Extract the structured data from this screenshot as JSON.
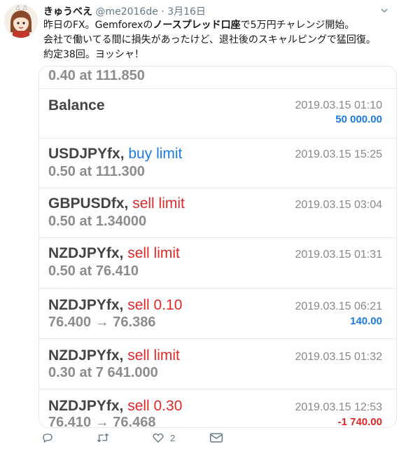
{
  "tweet": {
    "display_name": "きゅうべえ",
    "handle": "@me2016de",
    "separator": "·",
    "date": "3月16日",
    "text_line1_pre": "昨日のFX。Gemforexの",
    "text_line1_bold": "ノースプレッド口座",
    "text_line1_post": "で5万円チャレンジ開始。",
    "text_line2": "会社で働いてる間に損失があったけど、退社後のスキャルピングで猛回復。",
    "text_line3": "約定38回。ヨッシャ！"
  },
  "trades": [
    {
      "symbol": "",
      "action": "",
      "action_type": "",
      "detail": "0.40 at 111.850",
      "time": "",
      "profit": "",
      "profit_type": ""
    },
    {
      "symbol": "Balance",
      "action": "",
      "action_type": "",
      "detail": "",
      "time": "2019.03.15 01:10",
      "profit": "50 000.00",
      "profit_type": "positive"
    },
    {
      "symbol": "USDJPYfx",
      "action": "buy limit",
      "action_type": "buy",
      "detail": "0.50 at 111.300",
      "time": "2019.03.15 15:25",
      "profit": "",
      "profit_type": ""
    },
    {
      "symbol": "GBPUSDfx",
      "action": "sell limit",
      "action_type": "sell",
      "detail": "0.50 at 1.34000",
      "time": "2019.03.15 03:04",
      "profit": "",
      "profit_type": ""
    },
    {
      "symbol": "NZDJPYfx",
      "action": "sell limit",
      "action_type": "sell",
      "detail": "0.50 at 76.410",
      "time": "2019.03.15 01:31",
      "profit": "",
      "profit_type": ""
    },
    {
      "symbol": "NZDJPYfx",
      "action": "sell 0.10",
      "action_type": "sell",
      "detail": "76.400 → 76.386",
      "time": "2019.03.15 06:21",
      "profit": "140.00",
      "profit_type": "positive"
    },
    {
      "symbol": "NZDJPYfx",
      "action": "sell limit",
      "action_type": "sell",
      "detail": "0.30 at 7 641.000",
      "time": "2019.03.15 01:32",
      "profit": "",
      "profit_type": ""
    },
    {
      "symbol": "NZDJPYfx",
      "action": "sell 0.30",
      "action_type": "sell",
      "detail": "76.410 → 76.468",
      "time": "2019.03.15 12:53",
      "profit": "-1 740.00",
      "profit_type": "negative"
    }
  ],
  "actions": {
    "reply_icon": "reply-icon",
    "retweet_icon": "retweet-icon",
    "like_icon": "heart-icon",
    "like_count": "2",
    "dm_icon": "mail-icon"
  },
  "colors": {
    "buy": "#1e7be0",
    "sell": "#e02828",
    "profit_positive": "#1e7be0",
    "profit_negative": "#e02828"
  }
}
